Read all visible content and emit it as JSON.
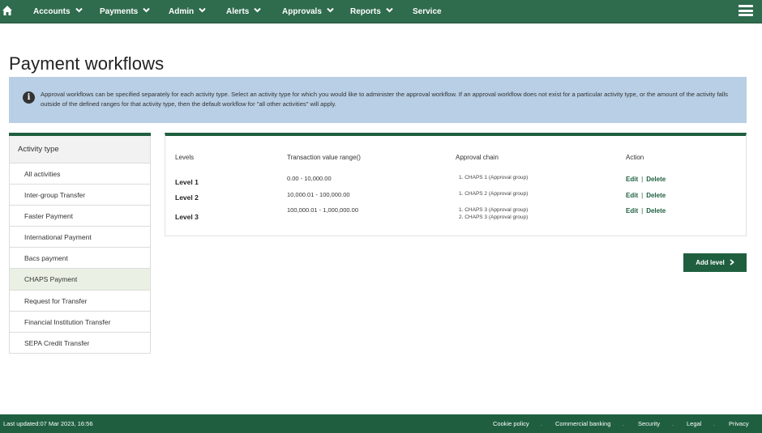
{
  "nav": {
    "items": [
      {
        "label": "Accounts"
      },
      {
        "label": "Payments"
      },
      {
        "label": "Admin"
      },
      {
        "label": "Alerts"
      },
      {
        "label": "Approvals"
      },
      {
        "label": "Reports"
      },
      {
        "label": "Service"
      }
    ]
  },
  "page": {
    "title": "Payment workflows"
  },
  "info": {
    "text": "Approval workflows can be specified separately for each activity type. Select an activity type for which you would like to administer the approval workflow. If an approval workflow does not exist for a particular activity type, or the amount of the activity falls outside of the defined ranges for that activity type, then the default workflow for \"all other activities\" will apply."
  },
  "activity": {
    "header": "Activity type",
    "items": [
      {
        "label": "All activities"
      },
      {
        "label": "Inter-group Transfer"
      },
      {
        "label": "Faster Payment"
      },
      {
        "label": "International Payment"
      },
      {
        "label": "Bacs payment"
      },
      {
        "label": "CHAPS Payment"
      },
      {
        "label": "Request for Transfer"
      },
      {
        "label": "Financial Institution Transfer"
      },
      {
        "label": "SEPA Credit Transfer"
      }
    ],
    "selected": "CHAPS Payment"
  },
  "levels": {
    "columns": {
      "levels": "Levels",
      "range": "Transaction value range()",
      "chain": "Approval chain",
      "action": "Action"
    },
    "rows": [
      {
        "name": "Level 1",
        "range": "0.00 - 10,000.00",
        "chain": [
          "1. CHAPS 1 (Approval group)"
        ],
        "edit": "Edit",
        "delete": "Delete"
      },
      {
        "name": "Level 2",
        "range": "10,000.01 - 100,000.00",
        "chain": [
          "1. CHAPS 2 (Approval group)"
        ],
        "edit": "Edit",
        "delete": "Delete"
      },
      {
        "name": "Level 3",
        "range": "100,000.01 - 1,000,000.00",
        "chain": [
          "1. CHAPS 3 (Approval group)",
          "2. CHAPS 3 (Approval group)"
        ],
        "edit": "Edit",
        "delete": "Delete"
      }
    ],
    "separator": "|"
  },
  "add_level": {
    "label": "Add level"
  },
  "footer": {
    "last_updated": "Last updated:07 Mar 2023, 16:56",
    "links": [
      {
        "label": "Cookie policy"
      },
      {
        "label": "Commercial banking"
      },
      {
        "label": "Security"
      },
      {
        "label": "Legal"
      },
      {
        "label": "Privacy"
      }
    ],
    "dot": "."
  },
  "colors": {
    "nav_bg": "#2f6b4d",
    "accent": "#1f5f3f",
    "info_bg": "#b8cfe5",
    "selected_bg": "#eaf1e4"
  }
}
